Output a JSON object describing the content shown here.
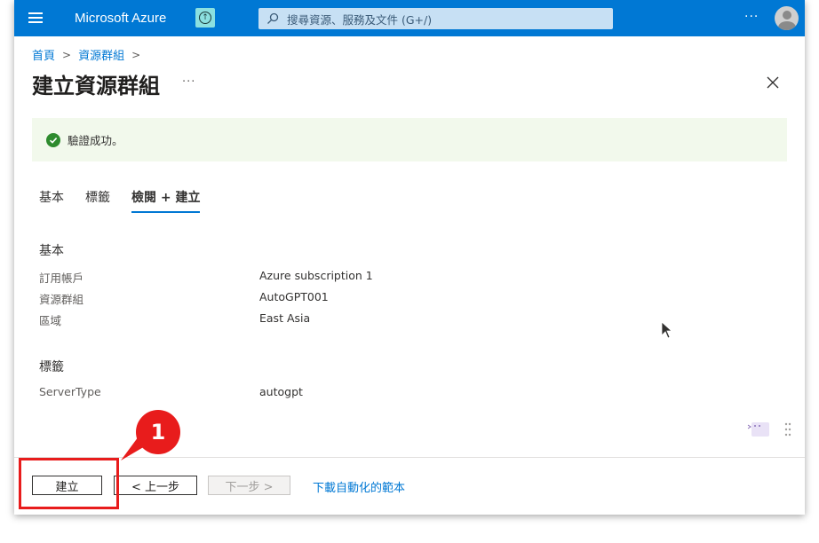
{
  "topbar": {
    "brand": "Microsoft Azure",
    "search_placeholder": "搜尋資源、服務及文件 (G+/)",
    "more": "···"
  },
  "breadcrumb": {
    "items": [
      "首頁",
      "資源群組"
    ]
  },
  "page": {
    "title": "建立資源群組",
    "more": "···"
  },
  "banner": {
    "message": "驗證成功。"
  },
  "tabs": [
    {
      "label": "基本",
      "active": false
    },
    {
      "label": "標籤",
      "active": false
    },
    {
      "label": "檢閱 + 建立",
      "active": true
    }
  ],
  "basics": {
    "heading": "基本",
    "rows": [
      {
        "label": "訂用帳戶",
        "value": "Azure subscription 1"
      },
      {
        "label": "資源群組",
        "value": "AutoGPT001"
      },
      {
        "label": "區域",
        "value": "East Asia"
      }
    ]
  },
  "tags": {
    "heading": "標籤",
    "rows": [
      {
        "label": "ServerType",
        "value": "autogpt"
      }
    ]
  },
  "footer": {
    "create": "建立",
    "prev": "< 上一步",
    "next": "下一步 >",
    "download": "下載自動化的範本"
  },
  "annotation": {
    "number": "1",
    "color": "#e81c1c"
  },
  "colors": {
    "accent": "#0078d4",
    "success": "#2e8b2e",
    "banner_bg": "#f2f9ec"
  }
}
